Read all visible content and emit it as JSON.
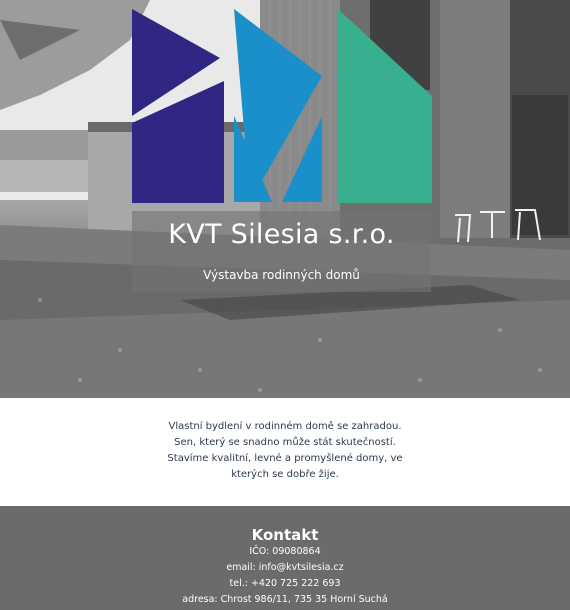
{
  "brand": {
    "colors": {
      "navy": "#2f2783",
      "blue": "#1b8fc9",
      "green": "#38b08f"
    }
  },
  "hero": {
    "image": "modern-wooden-house-grayscale",
    "title": "KVT Silesia s.r.o.",
    "subtitle": "Výstavba rodinných domů"
  },
  "intro": {
    "line1": "Vlastní bydlení v rodinném domě se zahradou.",
    "line2": "Sen, který se snadno může stát skutečností.",
    "line3": "Stavíme kvalitní, levné a promyšlené domy, ve kterých se dobře žije."
  },
  "contact": {
    "heading": "Kontakt",
    "ico": "IČO: 09080864",
    "email": "email: info@kvtsilesia.cz",
    "phone": "tel.: +420 725 222 693",
    "address": "adresa: Chrost 986/11, 735 35 Horní Suchá"
  }
}
